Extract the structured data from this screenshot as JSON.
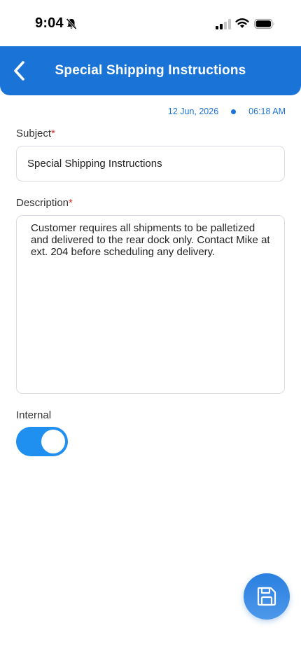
{
  "status_bar": {
    "time": "9:04",
    "icons": [
      "bell-slash-icon",
      "signal-icon",
      "wifi-icon",
      "battery-icon"
    ]
  },
  "header": {
    "title": "Special Shipping Instructions",
    "back_icon": "chevron-left-icon",
    "color": "#1a74d8"
  },
  "timestamp": {
    "date": "12 Jun, 2026",
    "time": "06:18 AM"
  },
  "form": {
    "subject": {
      "label": "Subject",
      "required_marker": "*",
      "value": "Special Shipping Instructions"
    },
    "description": {
      "label": "Description",
      "required_marker": "*",
      "value": "Customer requires all shipments to be palletized and delivered to the rear dock only. Contact Mike at ext. 204 before scheduling any delivery."
    },
    "internal": {
      "label": "Internal",
      "enabled": true
    }
  },
  "fab": {
    "icon": "save-icon"
  },
  "colors": {
    "accent": "#1a74d8",
    "toggle_on": "#1f8ff0",
    "required": "#d32f2f"
  }
}
